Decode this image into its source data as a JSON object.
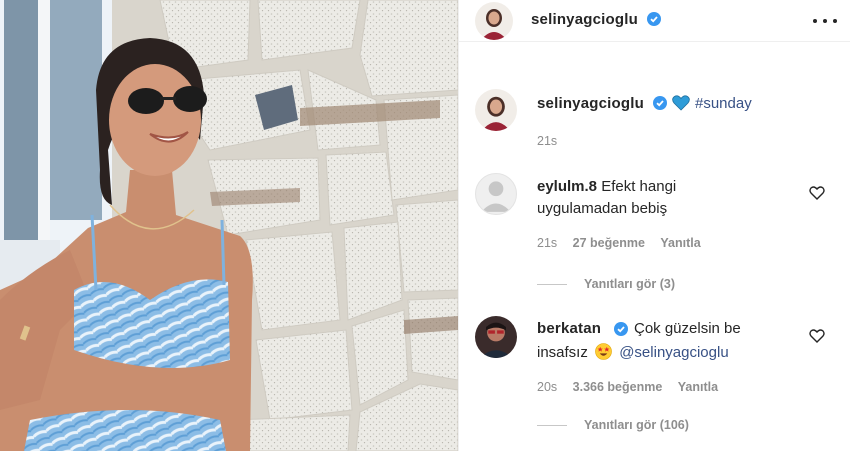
{
  "post": {
    "author": "selinyagcioglu",
    "menu_icon": "more-horizontal-icon",
    "caption": {
      "username": "selinyagcioglu",
      "emoji": "blue-heart-icon",
      "hashtag": "#sunday",
      "time": "21s"
    }
  },
  "comments": [
    {
      "username": "eylulm.8",
      "text_line1": "Efekt hangi",
      "text_line2": "uygulamadan bebiş",
      "time": "21s",
      "likes": "27 beğenme",
      "reply": "Yanıtla",
      "view_replies": "Yanıtları gör (3)"
    },
    {
      "username": "berkatan",
      "text_line1": "Çok güzelsin be",
      "text_line2_pre": "insafsız",
      "text_line2_emoji": "star-struck-emoji-icon",
      "mention": "@selinyagcioglu",
      "time": "20s",
      "likes": "3.366 beğenme",
      "reply": "Yanıtla",
      "view_replies": "Yanıtları gör (106)"
    }
  ],
  "colors": {
    "verified": "#3897f0",
    "link": "#385185",
    "muted": "#8e8e8e",
    "emoji_heart": "#2e9cd8"
  }
}
